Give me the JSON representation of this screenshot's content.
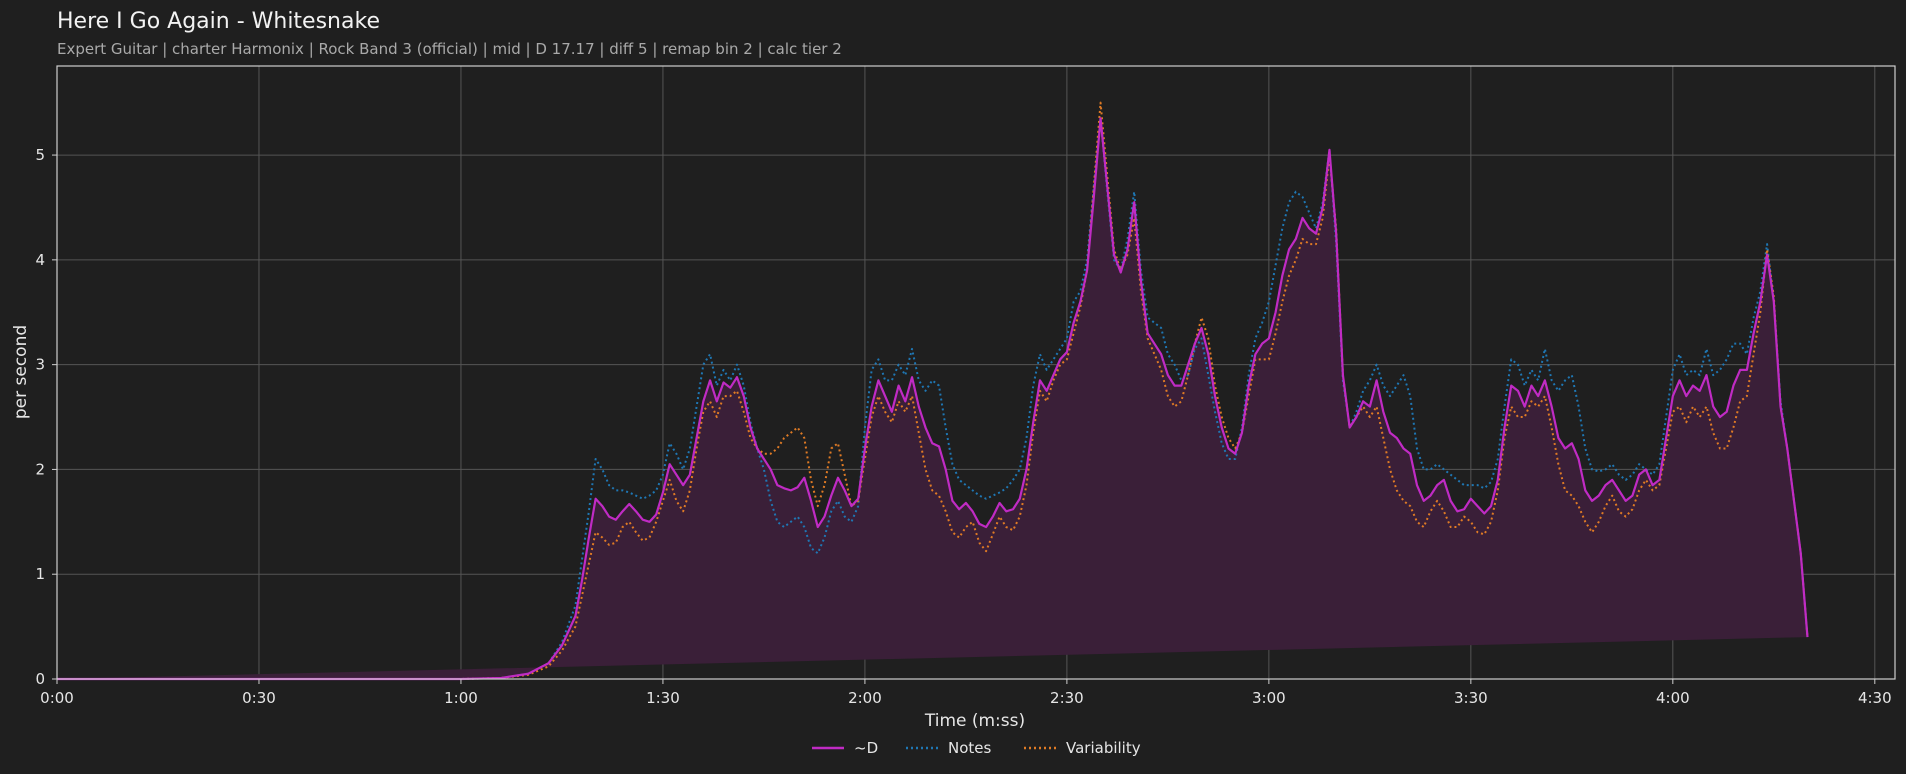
{
  "chart_data": {
    "type": "line",
    "title": "Here I Go Again - Whitesnake",
    "subtitle": "Expert Guitar  |  charter Harmonix  |  Rock Band 3 (official)  |  mid  |  D 17.17  |  diff 5  |  remap bin 2  |  calc tier 2",
    "xlabel": "Time (m:ss)",
    "ylabel": "per second",
    "xlim": [
      0,
      273
    ],
    "ylim": [
      0,
      5.85
    ],
    "x_ticks": [
      {
        "value": 0,
        "label": "0:00"
      },
      {
        "value": 30,
        "label": "0:30"
      },
      {
        "value": 60,
        "label": "1:00"
      },
      {
        "value": 90,
        "label": "1:30"
      },
      {
        "value": 120,
        "label": "2:00"
      },
      {
        "value": 150,
        "label": "2:30"
      },
      {
        "value": 180,
        "label": "3:00"
      },
      {
        "value": 210,
        "label": "3:30"
      },
      {
        "value": 240,
        "label": "4:00"
      },
      {
        "value": 270,
        "label": "4:30"
      }
    ],
    "y_ticks": [
      {
        "value": 0,
        "label": "0"
      },
      {
        "value": 1,
        "label": "1"
      },
      {
        "value": 2,
        "label": "2"
      },
      {
        "value": 3,
        "label": "3"
      },
      {
        "value": 4,
        "label": "4"
      },
      {
        "value": 5,
        "label": "5"
      }
    ],
    "grid": true,
    "legend_position": "bottom-center",
    "colors": {
      "background": "#1f1f1f",
      "plot_bg": "#1f1f1f",
      "grid": "#555555",
      "axis": "#cfcfcf",
      "area_fill": "#3a1f38"
    },
    "x": [
      0,
      10,
      20,
      30,
      40,
      50,
      60,
      66,
      70,
      73,
      75,
      77,
      78,
      79,
      80,
      81,
      82,
      83,
      84,
      85,
      86,
      87,
      88,
      89,
      90,
      91,
      92,
      93,
      94,
      95,
      96,
      97,
      98,
      99,
      100,
      101,
      102,
      103,
      104,
      105,
      106,
      107,
      108,
      109,
      110,
      111,
      112,
      113,
      114,
      115,
      116,
      117,
      118,
      119,
      120,
      121,
      122,
      123,
      124,
      125,
      126,
      127,
      128,
      129,
      130,
      131,
      132,
      133,
      134,
      135,
      136,
      137,
      138,
      139,
      140,
      141,
      142,
      143,
      144,
      145,
      146,
      147,
      148,
      149,
      150,
      151,
      152,
      153,
      154,
      155,
      156,
      157,
      158,
      159,
      160,
      161,
      162,
      163,
      164,
      165,
      166,
      167,
      168,
      169,
      170,
      171,
      172,
      173,
      174,
      175,
      176,
      177,
      178,
      179,
      180,
      181,
      182,
      183,
      184,
      185,
      186,
      187,
      188,
      189,
      190,
      191,
      192,
      193,
      194,
      195,
      196,
      197,
      198,
      199,
      200,
      201,
      202,
      203,
      204,
      205,
      206,
      207,
      208,
      209,
      210,
      211,
      212,
      213,
      214,
      215,
      216,
      217,
      218,
      219,
      220,
      221,
      222,
      223,
      224,
      225,
      226,
      227,
      228,
      229,
      230,
      231,
      232,
      233,
      234,
      235,
      236,
      237,
      238,
      239,
      240,
      241,
      242,
      243,
      244,
      245,
      246,
      247,
      248,
      249,
      250,
      251,
      252,
      253,
      254,
      255,
      256,
      257,
      258,
      259,
      260,
      261,
      262,
      263,
      264,
      265,
      266,
      267,
      268,
      269,
      270,
      271,
      272,
      273
    ],
    "series": [
      {
        "name": "~D",
        "color": "#c02bc4",
        "style": "solid",
        "values": [
          0,
          0,
          0,
          0,
          0,
          0,
          0,
          0.01,
          0.05,
          0.15,
          0.32,
          0.6,
          0.95,
          1.35,
          1.72,
          1.65,
          1.55,
          1.52,
          1.6,
          1.67,
          1.6,
          1.52,
          1.5,
          1.57,
          1.78,
          2.05,
          1.95,
          1.85,
          1.95,
          2.3,
          2.65,
          2.85,
          2.65,
          2.83,
          2.78,
          2.88,
          2.7,
          2.4,
          2.2,
          2.1,
          2.0,
          1.85,
          1.82,
          1.8,
          1.83,
          1.92,
          1.7,
          1.45,
          1.55,
          1.75,
          1.92,
          1.8,
          1.65,
          1.72,
          2.2,
          2.6,
          2.85,
          2.7,
          2.55,
          2.8,
          2.65,
          2.88,
          2.6,
          2.4,
          2.25,
          2.22,
          2.0,
          1.7,
          1.62,
          1.68,
          1.6,
          1.48,
          1.45,
          1.55,
          1.68,
          1.6,
          1.62,
          1.72,
          2.0,
          2.45,
          2.85,
          2.75,
          2.9,
          3.05,
          3.12,
          3.4,
          3.6,
          3.9,
          4.6,
          5.35,
          4.7,
          4.05,
          3.88,
          4.1,
          4.55,
          3.8,
          3.3,
          3.2,
          3.1,
          2.9,
          2.8,
          2.8,
          3.0,
          3.2,
          3.35,
          3.1,
          2.7,
          2.4,
          2.2,
          2.15,
          2.35,
          2.8,
          3.1,
          3.2,
          3.25,
          3.5,
          3.85,
          4.1,
          4.2,
          4.4,
          4.3,
          4.25,
          4.5,
          5.05,
          4.25,
          2.9,
          2.4,
          2.5,
          2.65,
          2.6,
          2.85,
          2.55,
          2.35,
          2.3,
          2.2,
          2.15,
          1.85,
          1.7,
          1.75,
          1.85,
          1.9,
          1.7,
          1.6,
          1.62,
          1.72,
          1.65,
          1.58,
          1.65,
          1.9,
          2.4,
          2.8,
          2.75,
          2.6,
          2.8,
          2.7,
          2.85,
          2.6,
          2.3,
          2.2,
          2.25,
          2.1,
          1.8,
          1.7,
          1.75,
          1.85,
          1.9,
          1.8,
          1.7,
          1.75,
          1.95,
          2.0,
          1.85,
          1.9,
          2.3,
          2.7,
          2.85,
          2.7,
          2.8,
          2.75,
          2.9,
          2.6,
          2.5,
          2.55,
          2.8,
          2.95,
          2.95,
          3.3,
          3.6,
          4.05,
          3.6,
          2.6,
          2.2,
          1.7,
          1.2,
          0.4
        ]
      },
      {
        "name": "Notes",
        "color": "#1f77b4",
        "style": "dotted",
        "values": [
          0,
          0,
          0,
          0,
          0,
          0,
          0,
          0.01,
          0.05,
          0.15,
          0.35,
          0.7,
          1.15,
          1.6,
          2.1,
          2.0,
          1.85,
          1.8,
          1.8,
          1.78,
          1.75,
          1.72,
          1.75,
          1.8,
          1.95,
          2.25,
          2.15,
          2.0,
          2.2,
          2.6,
          3.0,
          3.1,
          2.8,
          2.95,
          2.85,
          3.0,
          2.8,
          2.45,
          2.2,
          2.0,
          1.7,
          1.5,
          1.45,
          1.5,
          1.55,
          1.45,
          1.25,
          1.2,
          1.35,
          1.6,
          1.7,
          1.55,
          1.5,
          1.65,
          2.4,
          2.95,
          3.05,
          2.85,
          2.85,
          3.0,
          2.9,
          3.15,
          2.85,
          2.75,
          2.85,
          2.8,
          2.4,
          2.05,
          1.9,
          1.85,
          1.8,
          1.75,
          1.72,
          1.75,
          1.78,
          1.82,
          1.9,
          2.0,
          2.3,
          2.8,
          3.1,
          2.95,
          3.05,
          3.15,
          3.25,
          3.6,
          3.7,
          4.0,
          4.7,
          5.35,
          4.65,
          4.0,
          3.9,
          4.2,
          4.65,
          3.9,
          3.45,
          3.4,
          3.35,
          3.1,
          3.0,
          2.85,
          2.9,
          3.15,
          3.25,
          2.9,
          2.55,
          2.25,
          2.1,
          2.1,
          2.4,
          2.9,
          3.25,
          3.4,
          3.6,
          3.95,
          4.3,
          4.55,
          4.65,
          4.6,
          4.45,
          4.3,
          4.55,
          5.05,
          4.15,
          2.85,
          2.4,
          2.55,
          2.75,
          2.85,
          3.0,
          2.8,
          2.7,
          2.8,
          2.9,
          2.7,
          2.2,
          2.0,
          2.0,
          2.05,
          2.0,
          1.95,
          1.9,
          1.85,
          1.85,
          1.85,
          1.82,
          1.88,
          2.1,
          2.6,
          3.05,
          3.0,
          2.8,
          2.95,
          2.85,
          3.15,
          2.85,
          2.75,
          2.85,
          2.9,
          2.6,
          2.2,
          2.0,
          1.98,
          2.0,
          2.05,
          1.95,
          1.9,
          1.95,
          2.05,
          2.0,
          1.95,
          2.05,
          2.5,
          2.95,
          3.1,
          2.9,
          2.95,
          2.9,
          3.15,
          2.9,
          2.95,
          3.05,
          3.2,
          3.2,
          3.1,
          3.45,
          3.7,
          4.15,
          3.6,
          2.65,
          2.2,
          1.7,
          1.2,
          0.4
        ]
      },
      {
        "name": "Variability",
        "color": "#e07b25",
        "style": "dotted",
        "values": [
          0,
          0,
          0,
          0,
          0,
          0,
          0,
          0.01,
          0.04,
          0.12,
          0.27,
          0.5,
          0.8,
          1.1,
          1.4,
          1.35,
          1.28,
          1.3,
          1.45,
          1.5,
          1.4,
          1.32,
          1.35,
          1.5,
          1.7,
          1.9,
          1.7,
          1.6,
          1.8,
          2.2,
          2.55,
          2.65,
          2.5,
          2.7,
          2.7,
          2.75,
          2.55,
          2.3,
          2.2,
          2.15,
          2.15,
          2.2,
          2.3,
          2.35,
          2.4,
          2.3,
          1.9,
          1.65,
          1.85,
          2.2,
          2.25,
          1.95,
          1.65,
          1.7,
          2.1,
          2.5,
          2.7,
          2.55,
          2.45,
          2.65,
          2.55,
          2.7,
          2.35,
          2.0,
          1.8,
          1.75,
          1.6,
          1.4,
          1.35,
          1.45,
          1.5,
          1.3,
          1.22,
          1.38,
          1.55,
          1.45,
          1.42,
          1.55,
          1.85,
          2.35,
          2.75,
          2.65,
          2.85,
          3.0,
          3.05,
          3.3,
          3.55,
          3.9,
          4.7,
          5.5,
          4.8,
          4.1,
          3.9,
          4.05,
          4.4,
          3.7,
          3.25,
          3.1,
          2.95,
          2.7,
          2.6,
          2.65,
          2.9,
          3.2,
          3.45,
          3.25,
          2.8,
          2.5,
          2.3,
          2.2,
          2.35,
          2.7,
          3.05,
          3.05,
          3.05,
          3.3,
          3.6,
          3.85,
          4.0,
          4.2,
          4.15,
          4.15,
          4.4,
          5.0,
          4.3,
          2.9,
          2.4,
          2.5,
          2.6,
          2.5,
          2.6,
          2.3,
          2.0,
          1.8,
          1.7,
          1.65,
          1.5,
          1.45,
          1.6,
          1.7,
          1.6,
          1.45,
          1.45,
          1.55,
          1.5,
          1.4,
          1.38,
          1.5,
          1.8,
          2.3,
          2.6,
          2.5,
          2.5,
          2.65,
          2.6,
          2.7,
          2.4,
          2.05,
          1.8,
          1.75,
          1.65,
          1.5,
          1.4,
          1.5,
          1.65,
          1.75,
          1.6,
          1.55,
          1.62,
          1.8,
          1.9,
          1.8,
          1.85,
          2.2,
          2.55,
          2.6,
          2.45,
          2.6,
          2.5,
          2.6,
          2.35,
          2.2,
          2.2,
          2.4,
          2.65,
          2.7,
          3.1,
          3.5,
          4.1,
          3.65,
          2.6,
          2.2,
          1.7,
          1.2,
          0.4
        ]
      }
    ]
  }
}
